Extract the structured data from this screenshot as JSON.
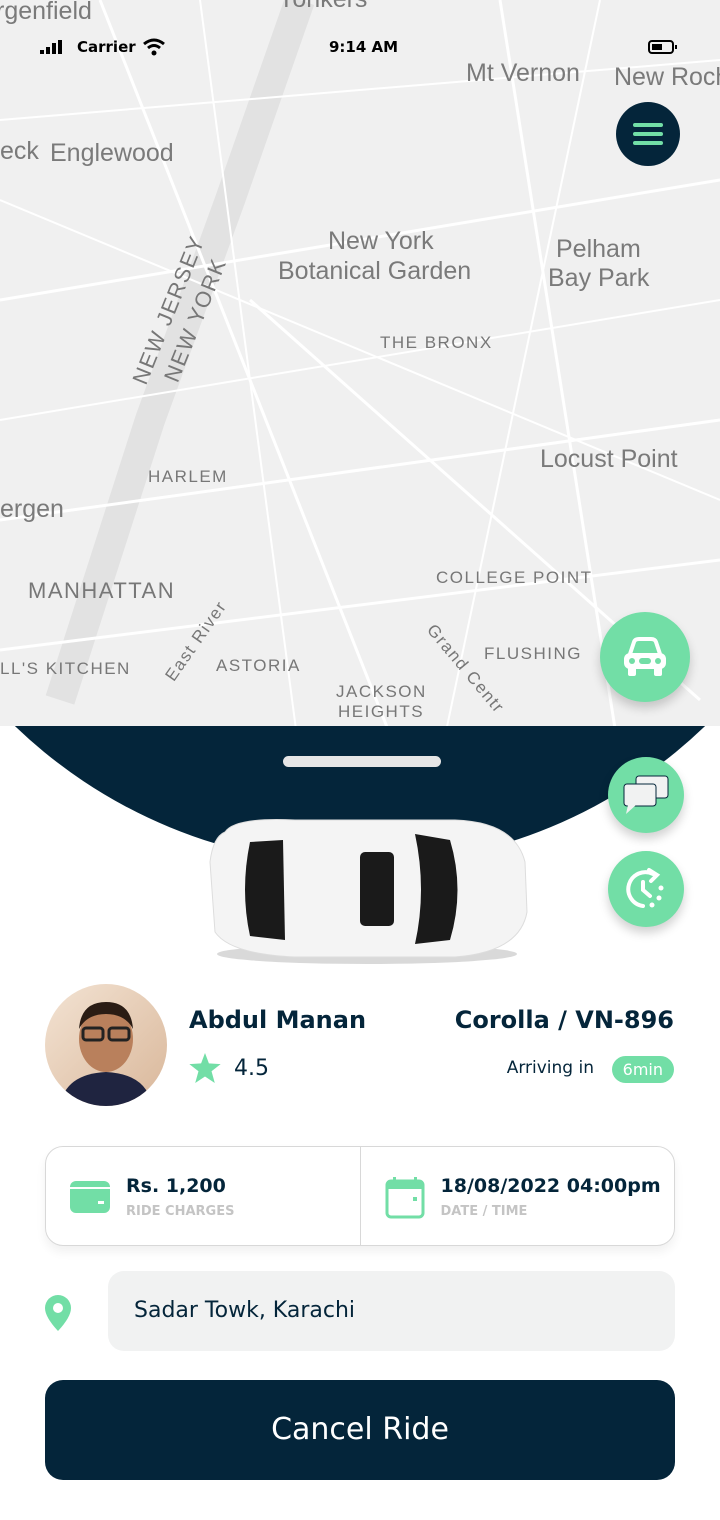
{
  "status_bar": {
    "carrier": "Carrier",
    "time": "9:14 AM"
  },
  "map": {
    "labels": [
      {
        "text": "rgenfield",
        "cls": "big"
      },
      {
        "text": "Yonkers",
        "cls": "big"
      },
      {
        "text": "Mt Vernon",
        "cls": "big"
      },
      {
        "text": "New Roch",
        "cls": "big"
      },
      {
        "text": "eck",
        "cls": "big"
      },
      {
        "text": "Englewood",
        "cls": "big"
      },
      {
        "text": "New York",
        "cls": "big"
      },
      {
        "text": "Botanical Garden",
        "cls": "big"
      },
      {
        "text": "Pelham",
        "cls": "big"
      },
      {
        "text": "Bay Park",
        "cls": "big"
      },
      {
        "text": "NEW JERSEY",
        "cls": "caps"
      },
      {
        "text": "NEW YORK",
        "cls": "caps"
      },
      {
        "text": "THE BRONX",
        "cls": "caps"
      },
      {
        "text": "Locust Point",
        "cls": "big"
      },
      {
        "text": "HARLEM",
        "cls": "caps"
      },
      {
        "text": "ergen",
        "cls": "big"
      },
      {
        "text": "MANHATTAN",
        "cls": "caps"
      },
      {
        "text": "COLLEGE POINT",
        "cls": "caps"
      },
      {
        "text": "East River",
        "cls": "caps"
      },
      {
        "text": "Grand Centr",
        "cls": "caps"
      },
      {
        "text": "FLUSHING",
        "cls": "caps"
      },
      {
        "text": "LL'S KITCHEN",
        "cls": "caps"
      },
      {
        "text": "ASTORIA",
        "cls": "caps"
      },
      {
        "text": "JACKSON",
        "cls": "caps"
      },
      {
        "text": "HEIGHTS",
        "cls": "caps"
      }
    ]
  },
  "driver": {
    "name": "Abdul Manan",
    "rating": "4.5"
  },
  "vehicle": {
    "model_plate": "Corolla  /  VN-896",
    "arriving_label": "Arriving in",
    "eta": "6min"
  },
  "ride": {
    "charges": "Rs. 1,200",
    "charges_label": "RIDE CHARGES",
    "datetime": "18/08/2022  04:00pm",
    "datetime_label": "DATE / TIME"
  },
  "location": {
    "value": "Sadar Towk, Karachi"
  },
  "cancel_label": "Cancel Ride",
  "colors": {
    "accent": "#72dea6",
    "dark": "#04253a"
  },
  "icons": [
    "menu-icon",
    "car-icon",
    "chat-icon",
    "clock-refresh-icon",
    "star-icon",
    "wallet-icon",
    "calendar-icon",
    "location-pin-icon"
  ]
}
